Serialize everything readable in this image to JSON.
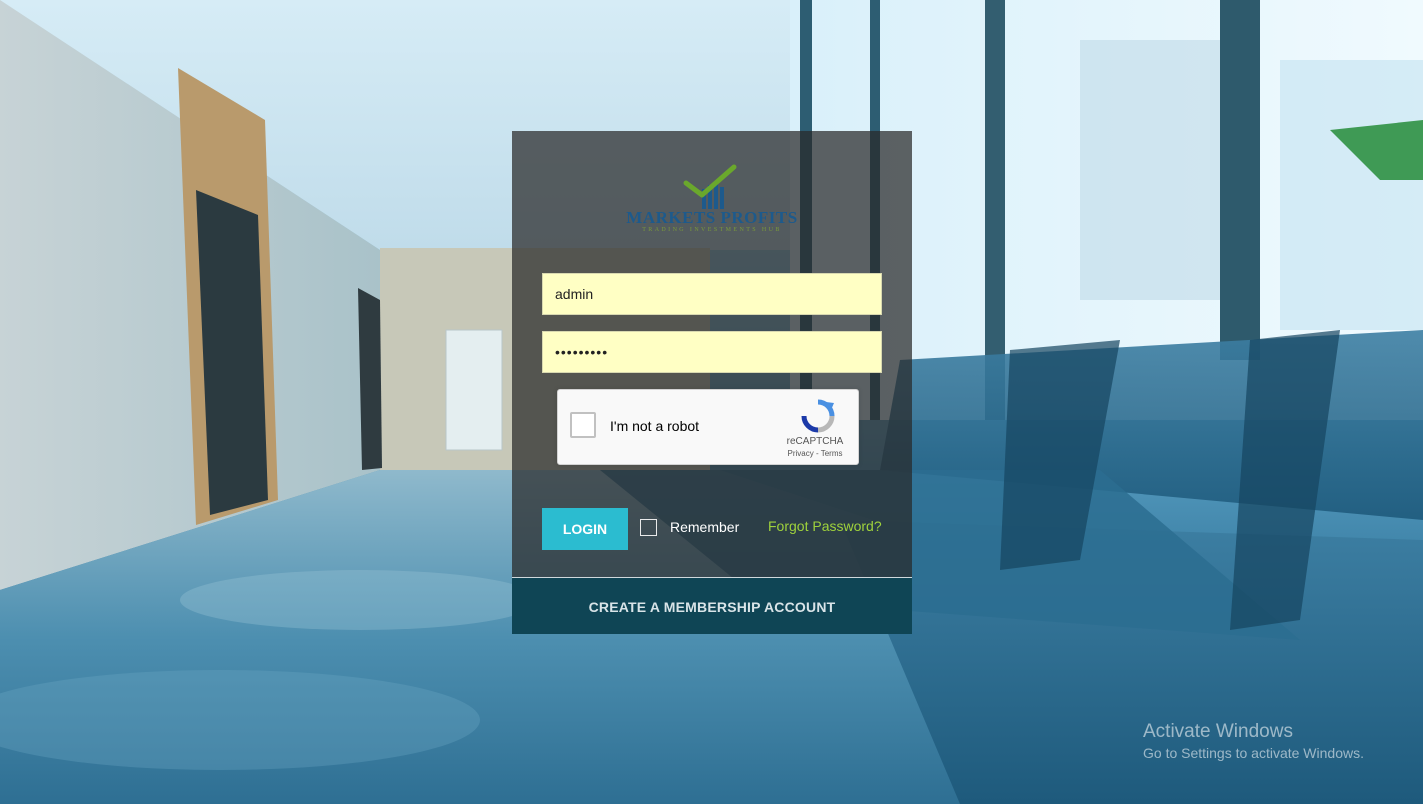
{
  "colors": {
    "field_bg": "#ffffc4",
    "login_button": "#2bbcd0",
    "forgot_link": "#9fd23c",
    "create_bar": "#0f4555",
    "panel_overlay": "rgba(40,40,40,0.72)"
  },
  "brand": {
    "name": "MARKETS PROFITS",
    "tagline": "TRADING INVESTMENTS HUB"
  },
  "form": {
    "username_value": "admin",
    "password_value": "•••••••••",
    "recaptcha": {
      "label": "I'm not a robot",
      "brand": "reCAPTCHA",
      "links": "Privacy - Terms"
    },
    "login_label": "LOGIN",
    "remember_label": "Remember",
    "forgot_label": "Forgot Password?",
    "create_account_label": "CREATE A MEMBERSHIP ACCOUNT"
  },
  "watermark": {
    "title": "Activate Windows",
    "subtitle": "Go to Settings to activate Windows."
  },
  "icons": [
    "checkmark-chart-logo-icon",
    "recaptcha-logo-icon"
  ]
}
